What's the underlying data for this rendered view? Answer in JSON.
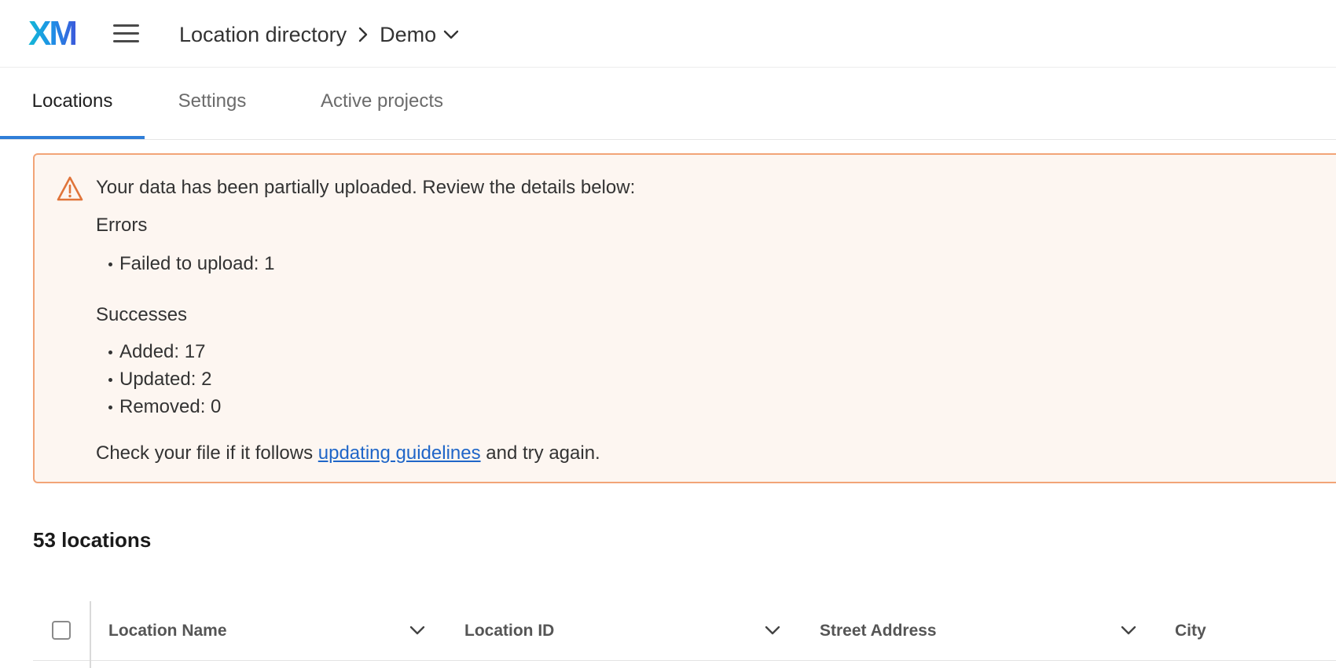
{
  "header": {
    "logo_text": "XM",
    "breadcrumb": {
      "parent": "Location directory",
      "current": "Demo"
    }
  },
  "tabs": [
    {
      "label": "Locations",
      "active": true
    },
    {
      "label": "Settings",
      "active": false
    },
    {
      "label": "Active projects",
      "active": false
    }
  ],
  "alert": {
    "message": "Your data has been partially uploaded. Review the details below:",
    "errors_heading": "Errors",
    "errors": [
      "Failed to upload: 1"
    ],
    "successes_heading": "Successes",
    "successes": [
      "Added: 17",
      "Updated: 2",
      "Removed: 0"
    ],
    "footer_before": "Check your file if it follows",
    "footer_link": "updating guidelines",
    "footer_after": "and try again.",
    "colors": {
      "border": "#f2a477",
      "background": "#fdf6f1",
      "icon": "#e0743a"
    }
  },
  "locations_count": "53 locations",
  "table": {
    "columns": [
      "Location Name",
      "Location ID",
      "Street Address",
      "City"
    ]
  },
  "icons": {
    "menu": "hamburger-icon",
    "breadcrumb_separator": "chevron-right-icon",
    "breadcrumb_dropdown": "chevron-down-icon",
    "alert": "warning-triangle-icon",
    "sort": "chevron-down-icon"
  },
  "colors": {
    "accent": "#2f7ed8",
    "link": "#1f66c8"
  }
}
